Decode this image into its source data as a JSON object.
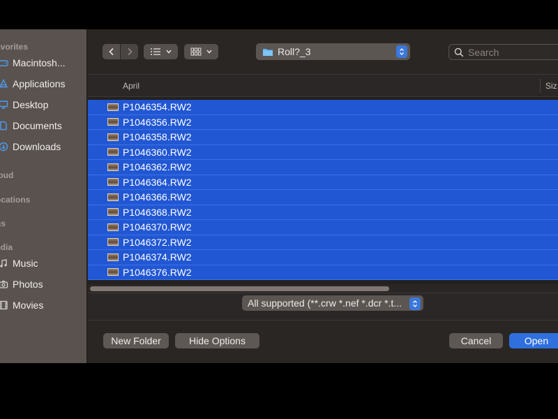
{
  "sidebar": {
    "sections": {
      "favorites": "avorites",
      "icloud": "loud",
      "locations": "ocations",
      "tags": "gs",
      "media": "edia"
    },
    "favorites": [
      {
        "label": "Macintosh...",
        "icon": "hard-drive-icon"
      },
      {
        "label": "Applications",
        "icon": "applications-icon"
      },
      {
        "label": "Desktop",
        "icon": "desktop-icon"
      },
      {
        "label": "Documents",
        "icon": "document-icon"
      },
      {
        "label": "Downloads",
        "icon": "download-icon"
      }
    ],
    "media": [
      {
        "label": "Music",
        "icon": "music-note-icon"
      },
      {
        "label": "Photos",
        "icon": "camera-icon"
      },
      {
        "label": "Movies",
        "icon": "film-icon"
      }
    ]
  },
  "toolbar": {
    "location": "Roll?_3",
    "search_placeholder": "Search"
  },
  "browser": {
    "group_header": "April",
    "size_header": "Siz",
    "files": [
      "P1046354.RW2",
      "P1046356.RW2",
      "P1046358.RW2",
      "P1046360.RW2",
      "P1046362.RW2",
      "P1046364.RW2",
      "P1046366.RW2",
      "P1046368.RW2",
      "P1046370.RW2",
      "P1046372.RW2",
      "P1046374.RW2",
      "P1046376.RW2"
    ]
  },
  "filter": {
    "selected": "All supported (**.crw *.nef *.dcr *.t..."
  },
  "buttons": {
    "new_folder": "New Folder",
    "hide_options": "Hide Options",
    "cancel": "Cancel",
    "open": "Open"
  },
  "colors": {
    "selection": "#2257d3",
    "accent": "#2f6fde",
    "sidebar_bg": "#59524f",
    "dialog_bg": "#2a2624"
  }
}
